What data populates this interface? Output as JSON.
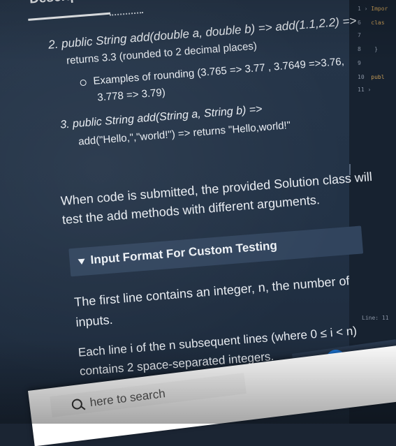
{
  "description": {
    "title": "Description",
    "item2_line1": "2. public String add(double a, double b) => add(1.1,2.2) =>",
    "item2_line2": "returns 3.3 (rounded to 2 decimal places)",
    "bullet_line1": "Examples of rounding (3.765 => 3.77 , 3.7649 =>3.76,",
    "bullet_line2": "3.778 => 3.79)",
    "item3_line1": "3. public String add(String a, String b) =>",
    "item3_line2": "add(\"Hello,\",\"world!\") => returns \"Hello,world!\"",
    "submit_line1": "When code is submitted, the provided Solution class will",
    "submit_line2": "test the add methods with different arguments."
  },
  "input_format": {
    "header": "Input Format For Custom Testing",
    "line1": "The first line contains an integer, n, the number of",
    "line2": "inputs.",
    "line3": "Each line i of the n subsequent lines (where 0 ≤ i < n)",
    "line4": "contains 2 space-separated integers."
  },
  "taskbar": {
    "search_placeholder": "here to search"
  },
  "editor": {
    "lines": [
      {
        "num": "1",
        "text": "Impor"
      },
      {
        "num": "6",
        "text": "clas"
      },
      {
        "num": "7",
        "text": ""
      },
      {
        "num": "8",
        "text": "}"
      },
      {
        "num": "9",
        "text": ""
      },
      {
        "num": "10",
        "text": "publ"
      },
      {
        "num": "11",
        "text": ""
      }
    ],
    "status": "Line: 11"
  },
  "colors": {
    "background": "#223246",
    "header_bar": "#31445d",
    "taskbar": "#ffffff"
  }
}
